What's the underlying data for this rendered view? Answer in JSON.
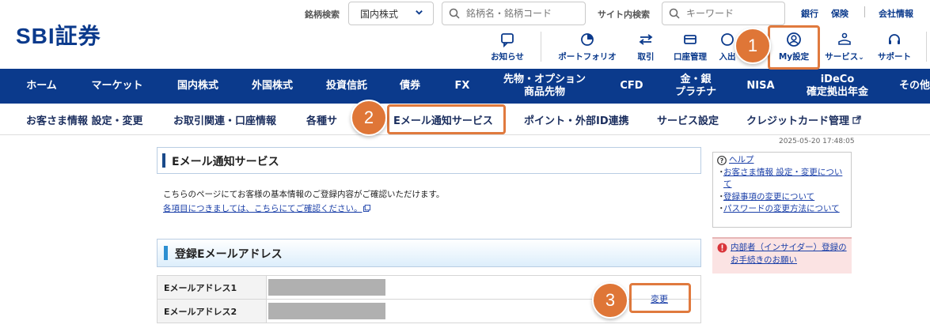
{
  "header": {
    "logo": "SBI証券",
    "stock_search_label": "銘柄検索",
    "market_select_value": "国内株式",
    "stock_search_placeholder": "銘柄名・銘柄コード",
    "site_search_label": "サイト内検索",
    "site_search_placeholder": "キーワード",
    "top_links": [
      "銀行",
      "保険",
      "会社情報"
    ],
    "icon_nav": [
      {
        "label": "お知らせ",
        "icon": "message-icon"
      },
      {
        "label": "ポートフォリオ",
        "icon": "portfolio-icon"
      },
      {
        "label": "取引",
        "icon": "trade-arrows-icon"
      },
      {
        "label": "口座管理",
        "icon": "account-card-icon"
      },
      {
        "label": "入出",
        "icon": "deposit-icon"
      },
      {
        "label": "My設定",
        "icon": "user-settings-icon"
      },
      {
        "label": "サービス",
        "icon": "service-icon"
      },
      {
        "label": "サポート",
        "icon": "headset-icon"
      }
    ]
  },
  "main_nav": [
    "ホーム",
    "マーケット",
    "国内株式",
    "外国株式",
    "投資信託",
    "債券",
    "FX",
    "先物・オプション\n商品先物",
    "CFD",
    "金・銀\nプラチナ",
    "NISA",
    "iDeCo\n確定拠出年金",
    "その他"
  ],
  "sub_nav": [
    "お客さま情報 設定・変更",
    "お取引関連・口座情報",
    "各種サ",
    "Eメール通知サービス",
    "ポイント・外部ID連携",
    "サービス設定",
    "クレジットカード管理"
  ],
  "timestamp": "2025-05-20 17:48:05",
  "page": {
    "title": "Eメール通知サービス",
    "intro": "こちらのページにてお客様の基本情報のご登録内容がご確認いただけます。",
    "intro_link": "各項目につきましては、こちらにてご確認ください。",
    "section_title": "登録Eメールアドレス",
    "email_rows": [
      {
        "label": "Eメールアドレス1"
      },
      {
        "label": "Eメールアドレス2"
      }
    ],
    "change_link": "変更"
  },
  "sidebar": {
    "help_title": "ヘルプ",
    "help_links": [
      "お客さま情報 設定・変更について",
      "登録事項の変更について",
      "パスワードの変更方法について"
    ],
    "insider_link": "内部者（インサイダー）登録のお手続きのお願い"
  },
  "annotations": {
    "badge1": "1",
    "badge2": "2",
    "badge3": "3",
    "color": "#df7637"
  }
}
